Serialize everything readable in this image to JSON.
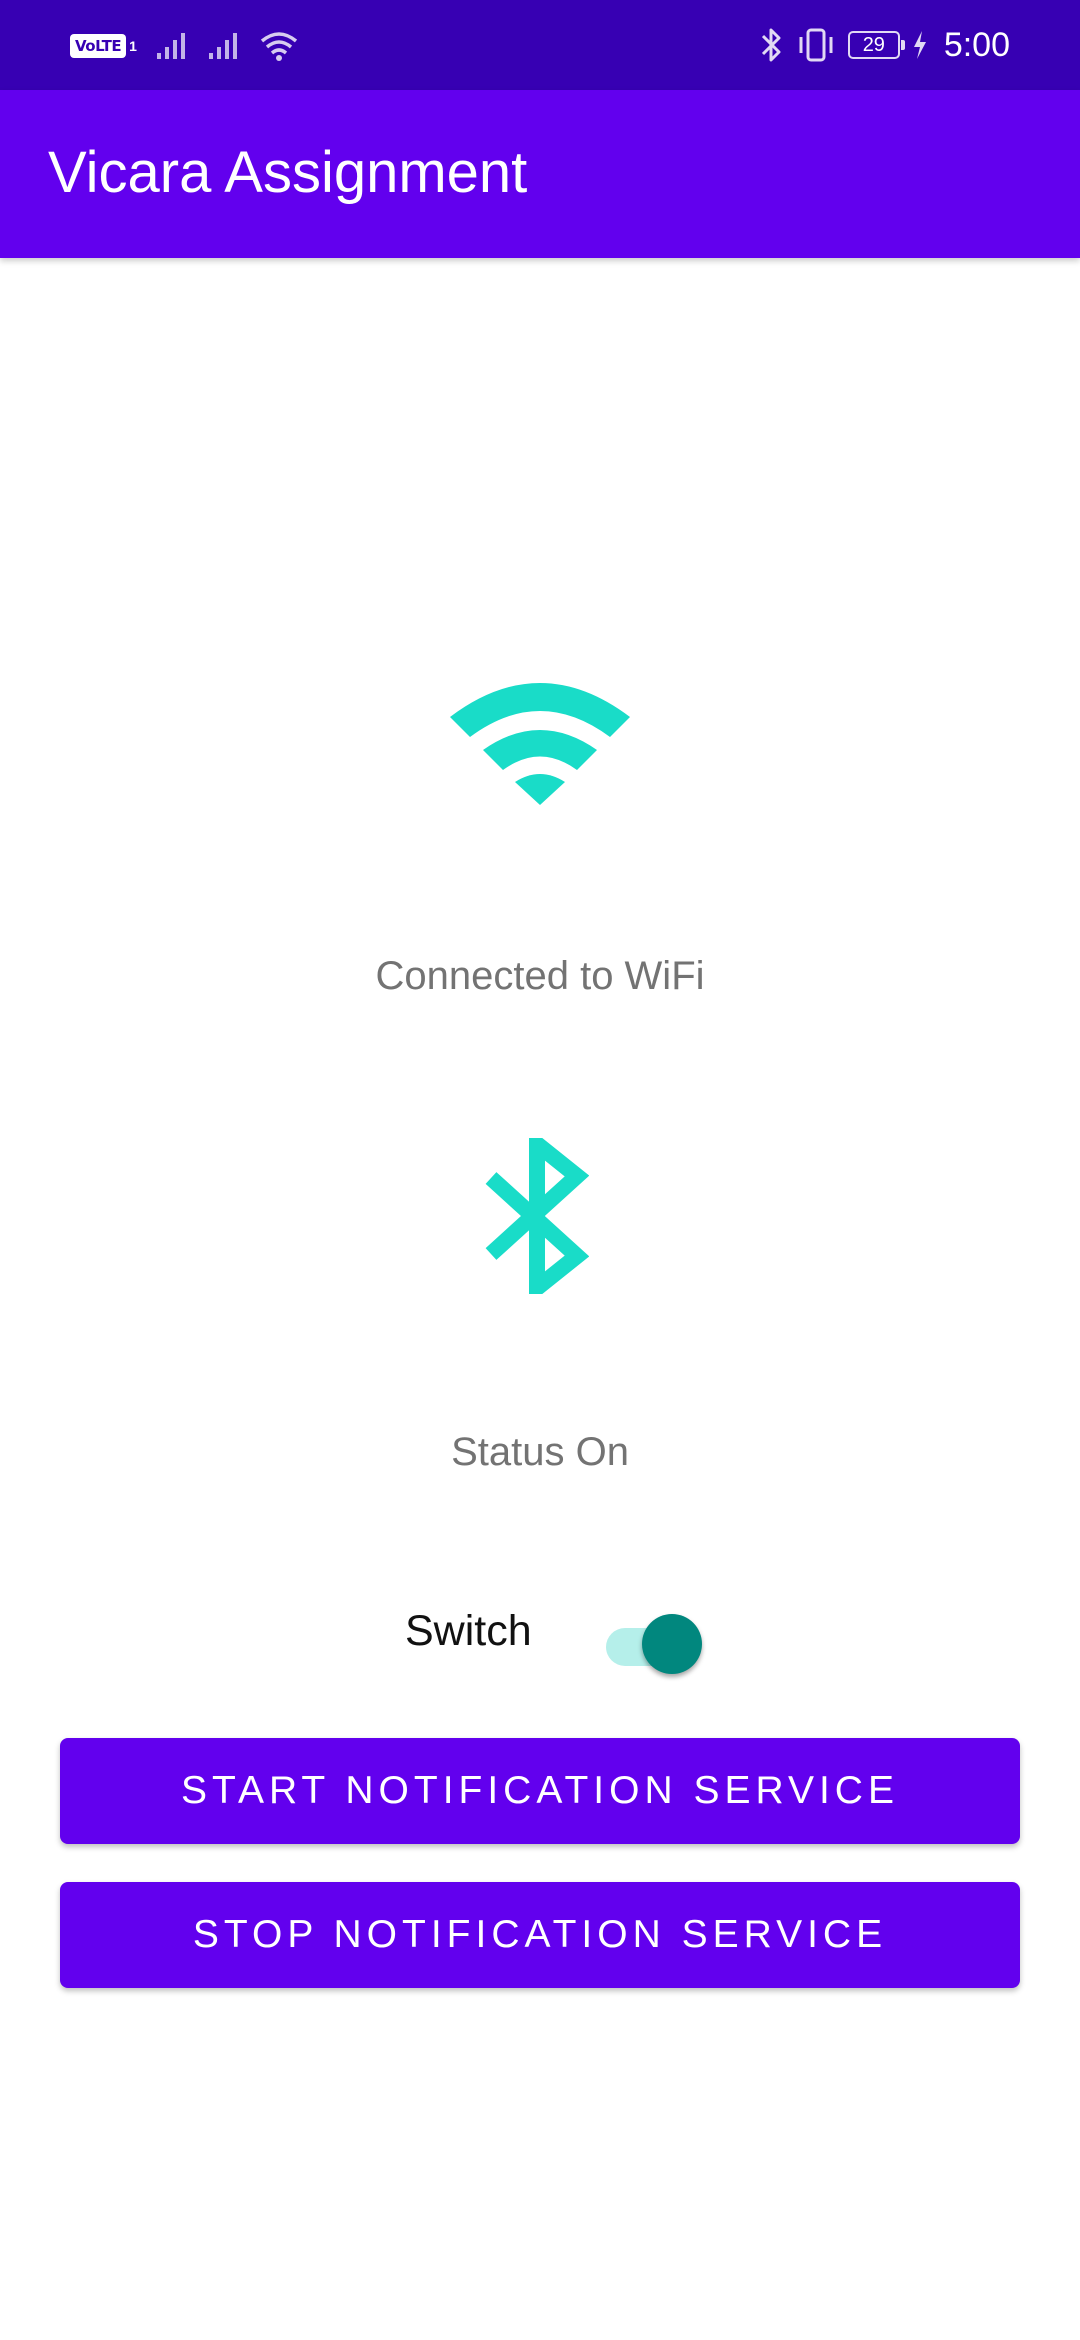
{
  "status_bar": {
    "volte_label": "VoLTE",
    "sim_indicator": "1",
    "battery_level": "29",
    "time": "5:00",
    "icons": [
      "volte-icon",
      "signal-icon",
      "signal-icon",
      "wifi-icon",
      "bluetooth-icon",
      "vibrate-icon",
      "battery-icon",
      "charging-icon"
    ]
  },
  "app_bar": {
    "title": "Vicara Assignment"
  },
  "wifi": {
    "icon": "wifi-icon",
    "status": "Connected to WiFi"
  },
  "bluetooth": {
    "icon": "bluetooth-icon",
    "status": "Status On"
  },
  "switch": {
    "label": "Switch",
    "checked": true
  },
  "buttons": {
    "start_label": "START NOTIFICATION SERVICE",
    "stop_label": "STOP NOTIFICATION SERVICE"
  },
  "colors": {
    "status_bar": "#3700b3",
    "primary": "#6200ee",
    "accent_icon": "#19dcc8",
    "switch_thumb": "#01877e",
    "switch_track": "#b5efea",
    "secondary_text": "#737373"
  }
}
